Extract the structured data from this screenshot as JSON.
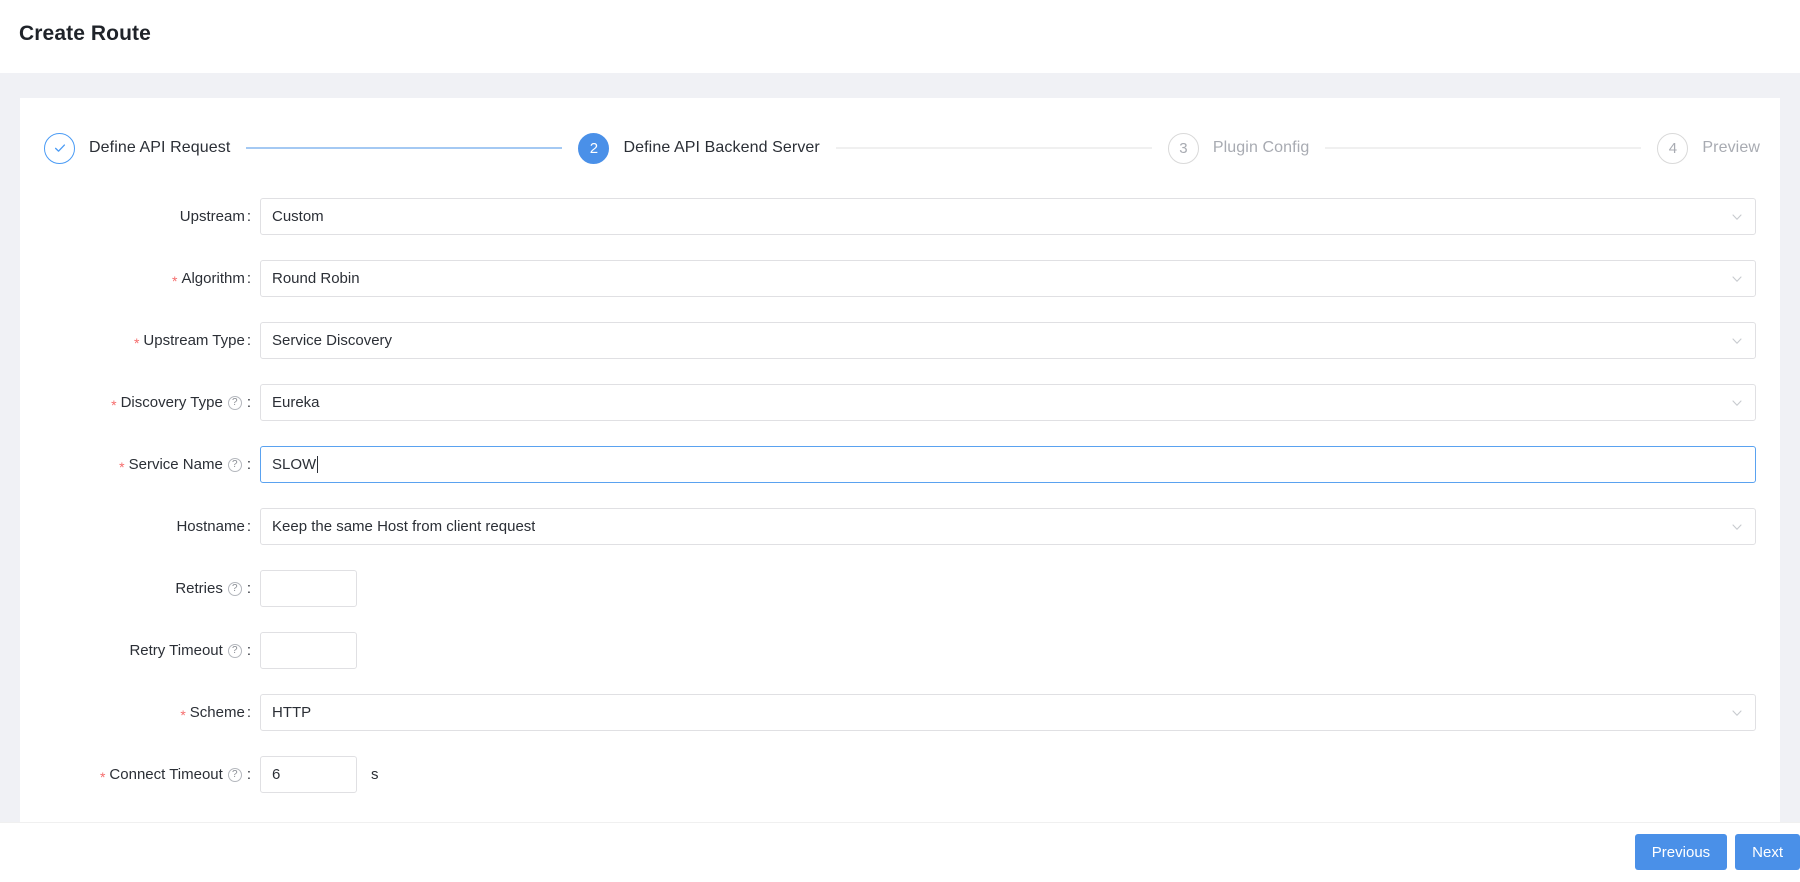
{
  "header": {
    "title": "Create Route"
  },
  "steps": [
    {
      "num": "1",
      "label": "Define API Request",
      "state": "done",
      "icon": "check-icon"
    },
    {
      "num": "2",
      "label": "Define API Backend Server",
      "state": "active"
    },
    {
      "num": "3",
      "label": "Plugin Config",
      "state": "todo"
    },
    {
      "num": "4",
      "label": "Preview",
      "state": "todo"
    }
  ],
  "form": {
    "rows": [
      {
        "id": "upstream",
        "label": "Upstream",
        "required": false,
        "help": false,
        "type": "select",
        "value": "Custom",
        "size": "wide",
        "focused": false,
        "suffix": ""
      },
      {
        "id": "algorithm",
        "label": "Algorithm",
        "required": true,
        "help": false,
        "type": "select",
        "value": "Round Robin",
        "size": "wide",
        "focused": false,
        "suffix": ""
      },
      {
        "id": "upstream-type",
        "label": "Upstream Type",
        "required": true,
        "help": false,
        "type": "select",
        "value": "Service Discovery",
        "size": "wide",
        "focused": false,
        "suffix": ""
      },
      {
        "id": "discovery-type",
        "label": "Discovery Type",
        "required": true,
        "help": true,
        "type": "select",
        "value": "Eureka",
        "size": "wide",
        "focused": false,
        "suffix": ""
      },
      {
        "id": "service-name",
        "label": "Service Name",
        "required": true,
        "help": true,
        "type": "text",
        "value": "SLOW",
        "size": "wide",
        "focused": true,
        "suffix": ""
      },
      {
        "id": "hostname",
        "label": "Hostname",
        "required": false,
        "help": false,
        "type": "select",
        "value": "Keep the same Host from client request",
        "size": "wide",
        "focused": false,
        "suffix": ""
      },
      {
        "id": "retries",
        "label": "Retries",
        "required": false,
        "help": true,
        "type": "text",
        "value": "",
        "size": "small",
        "focused": false,
        "suffix": ""
      },
      {
        "id": "retry-timeout",
        "label": "Retry Timeout",
        "required": false,
        "help": true,
        "type": "text",
        "value": "",
        "size": "small",
        "focused": false,
        "suffix": ""
      },
      {
        "id": "scheme",
        "label": "Scheme",
        "required": true,
        "help": false,
        "type": "select",
        "value": "HTTP",
        "size": "wide",
        "focused": false,
        "suffix": ""
      },
      {
        "id": "connect-timeout",
        "label": "Connect Timeout",
        "required": true,
        "help": true,
        "type": "text",
        "value": "6",
        "size": "small",
        "focused": false,
        "suffix": "s"
      }
    ],
    "help_glyph": "?",
    "required_glyph": "*",
    "colon": ":"
  },
  "footer": {
    "previous_label": "Previous",
    "next_label": "Next"
  },
  "colors": {
    "accent": "#4a90e8",
    "accent_light": "#a4c9f3",
    "focus_border": "#5aa2f0",
    "required_star": "#f56c6c",
    "page_bg": "#f0f1f5",
    "text": "#2b2f36",
    "muted_text": "#a8abb2",
    "field_border": "#e0e0e3"
  }
}
